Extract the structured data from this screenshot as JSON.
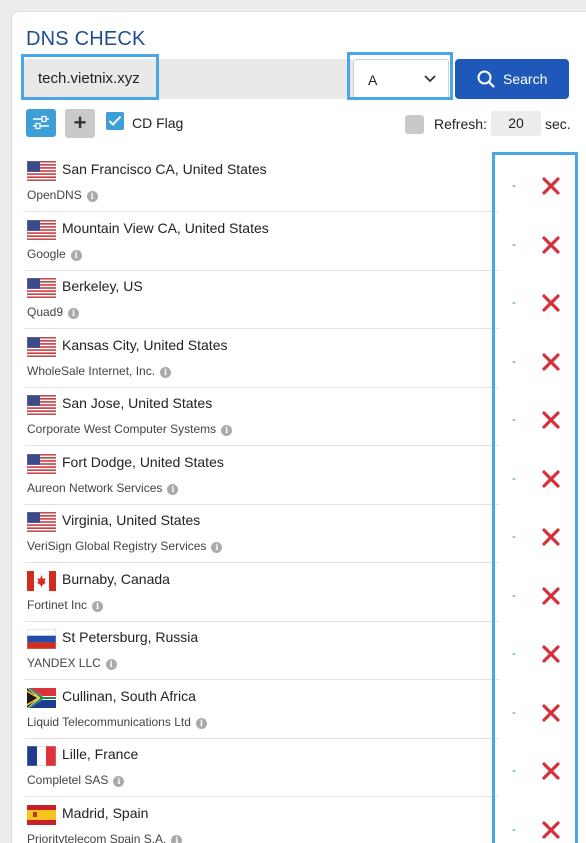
{
  "header": {
    "title": "DNS CHECK"
  },
  "search": {
    "domain_value": "tech.vietnix.xyz",
    "record_type": "A",
    "button_label": "Search"
  },
  "options": {
    "cd_flag_label": "CD Flag",
    "cd_flag_checked": true,
    "refresh_label": "Refresh:",
    "refresh_value": "20",
    "refresh_unit": "sec.",
    "refresh_checked": false
  },
  "results": [
    {
      "flag": "us-flag-icon",
      "location": "San Francisco CA, United States",
      "provider": "OpenDNS",
      "status": "-"
    },
    {
      "flag": "us-flag-icon",
      "location": "Mountain View CA, United States",
      "provider": "Google",
      "status": "-"
    },
    {
      "flag": "us-flag-icon",
      "location": "Berkeley, US",
      "provider": "Quad9",
      "status": "-"
    },
    {
      "flag": "us-flag-icon",
      "location": "Kansas City, United States",
      "provider": "WholeSale Internet, Inc.",
      "status": "-"
    },
    {
      "flag": "us-flag-icon",
      "location": "San Jose, United States",
      "provider": "Corporate West Computer Systems",
      "status": "-"
    },
    {
      "flag": "us-flag-icon",
      "location": "Fort Dodge, United States",
      "provider": "Aureon Network Services",
      "status": "-"
    },
    {
      "flag": "us-flag-icon",
      "location": "Virginia, United States",
      "provider": "VeriSign Global Registry Services",
      "status": "-"
    },
    {
      "flag": "ca-flag-icon",
      "location": "Burnaby, Canada",
      "provider": "Fortinet Inc",
      "status": "-"
    },
    {
      "flag": "ru-flag-icon",
      "location": "St Petersburg, Russia",
      "provider": "YANDEX LLC",
      "status": "-"
    },
    {
      "flag": "za-flag-icon",
      "location": "Cullinan, South Africa",
      "provider": "Liquid Telecommunications Ltd",
      "status": "-"
    },
    {
      "flag": "fr-flag-icon",
      "location": "Lille, France",
      "provider": "Completel SAS",
      "status": "-"
    },
    {
      "flag": "es-flag-icon",
      "location": "Madrid, Spain",
      "provider": "Prioritytelecom Spain S.A.",
      "status": "-"
    }
  ],
  "colors": {
    "accent": "#1e58b8",
    "title": "#1f4e8c",
    "highlight": "#4aa6e6",
    "fail": "#d6303a",
    "status": "#3a9c5a"
  }
}
